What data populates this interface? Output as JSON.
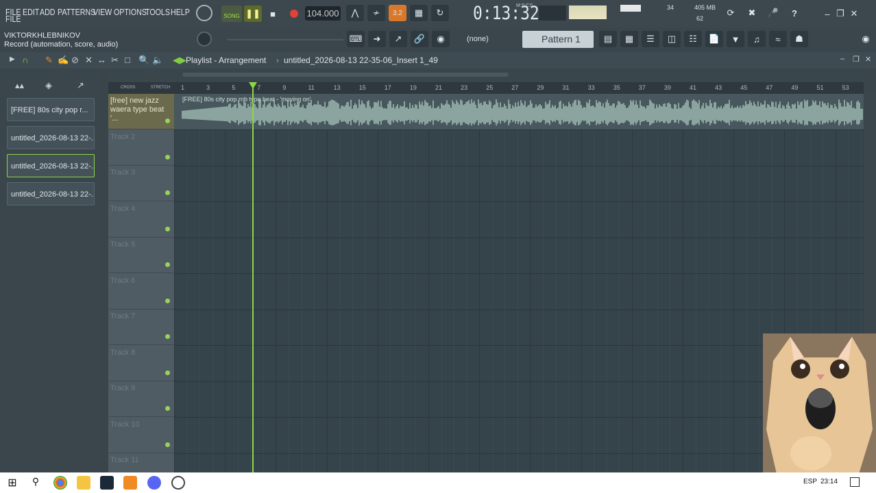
{
  "menu": [
    "FILE",
    "EDIT",
    "ADD",
    "PATTERNS",
    "VIEW",
    "OPTIONS",
    "TOOLS",
    "HELP"
  ],
  "transport": {
    "song_label": "SONG",
    "bpm": "104.000",
    "time": "0:13:32",
    "time_unit": "M:S:CS",
    "cpu": "34",
    "mem": "405 MB",
    "polyphony": "62"
  },
  "hint": {
    "user": "VIKTORKHLEBNIKOV",
    "text": "Record  (automation, score, audio)"
  },
  "pattern": {
    "none_label": "(none)",
    "name": "Pattern 1"
  },
  "playlist": {
    "title": "Playlist - Arrangement",
    "file": "untitled_2026-08-13 22-35-06_Insert 1_49"
  },
  "browser_items": [
    "[FREE] 80s city pop  r...",
    "untitled_2026-08-13 22-...",
    "untitled_2026-08-13 22-...",
    "untitled_2026-08-13 22-..."
  ],
  "tracks": [
    {
      "name": "[free] new jazz waera type beat '..."
    },
    {
      "name": "Track 2"
    },
    {
      "name": "Track 3"
    },
    {
      "name": "Track 4"
    },
    {
      "name": "Track 5"
    },
    {
      "name": "Track 6"
    },
    {
      "name": "Track 7"
    },
    {
      "name": "Track 8"
    },
    {
      "name": "Track 9"
    },
    {
      "name": "Track 10"
    },
    {
      "name": "Track 11"
    }
  ],
  "clip": {
    "label": "[FREE] 80s city pop  rnb type beat - 'moving on'"
  },
  "ruler_ticks": [
    "1",
    "3",
    "5",
    "7",
    "9",
    "11",
    "13",
    "15",
    "17",
    "19",
    "21",
    "23",
    "25",
    "27",
    "29",
    "31",
    "33",
    "35",
    "37",
    "39",
    "41",
    "43",
    "45",
    "47",
    "49",
    "51",
    "53"
  ],
  "timeline": {
    "cross": "CROSS",
    "stretch": "STRETCH"
  },
  "taskbar": {
    "lang": "ESP",
    "clock": "23:14"
  },
  "colors": {
    "accent": "#8bd847",
    "record": "#e0413a"
  }
}
